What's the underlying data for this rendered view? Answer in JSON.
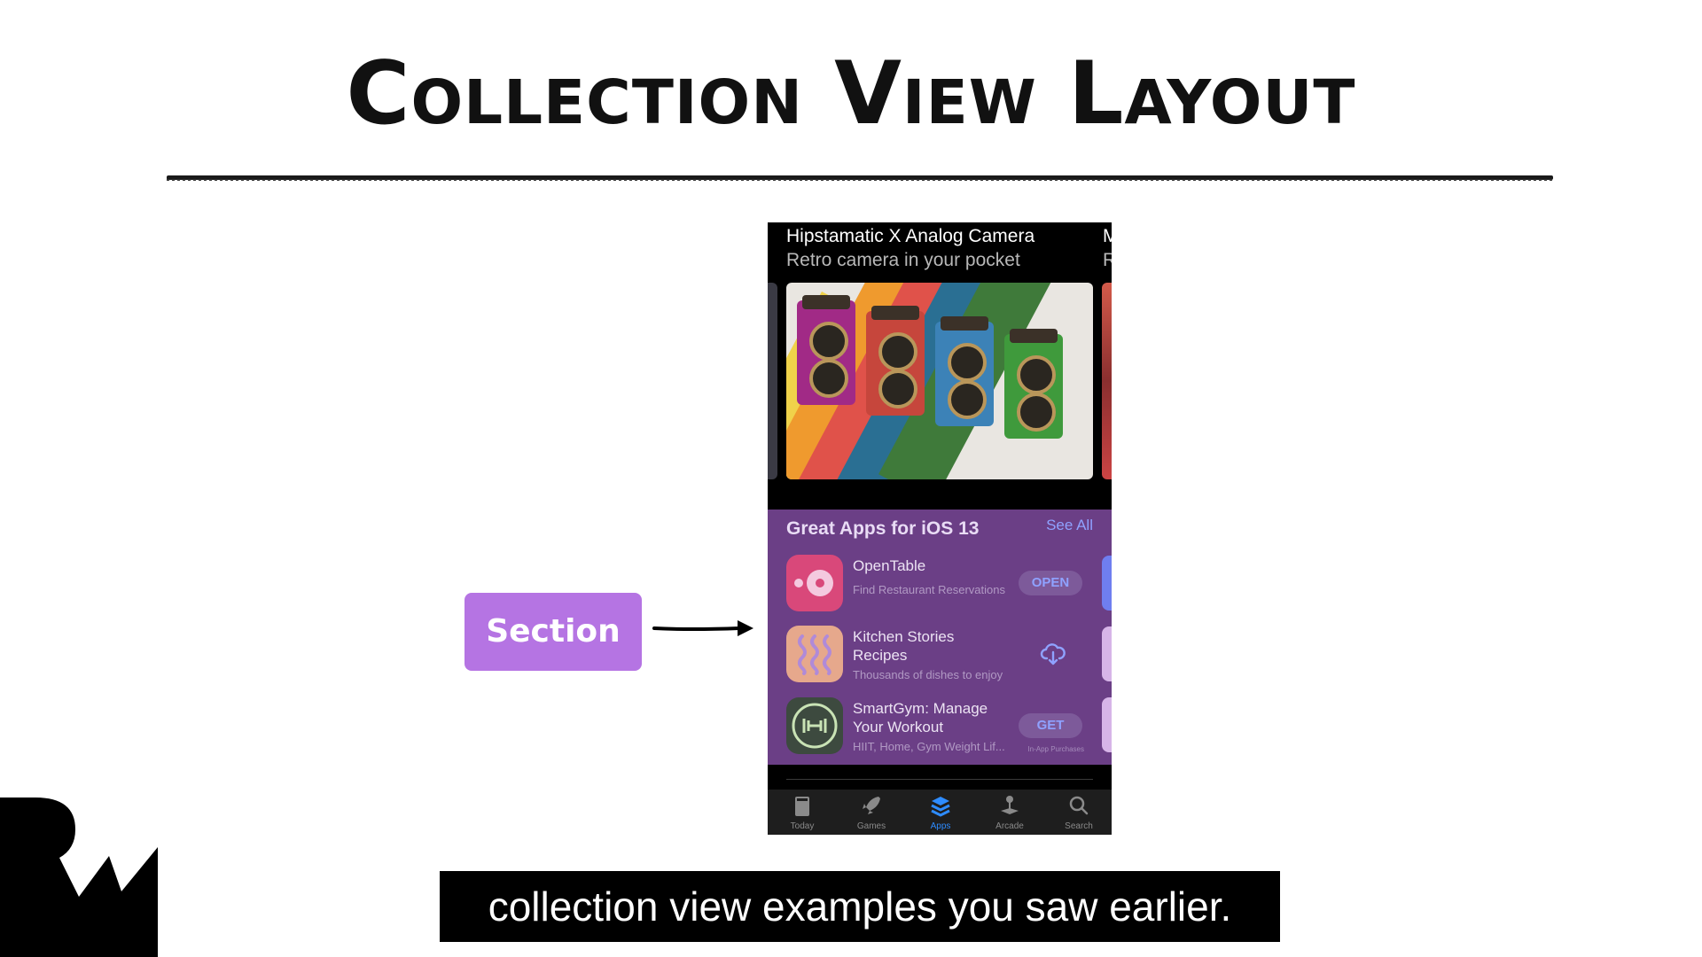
{
  "slide": {
    "title": "Collection View Layout",
    "section_label": "Section",
    "caption": "collection view examples you saw earlier."
  },
  "phone": {
    "featured": {
      "title": "Hipstamatic X Analog Camera",
      "subtitle": "Retro camera in your pocket",
      "peek_title": "M",
      "peek_subtitle": "R"
    },
    "section": {
      "title": "Great Apps for iOS 13",
      "see_all": "See All",
      "apps": [
        {
          "name": "OpenTable",
          "subtitle": "Find Restaurant Reservations",
          "action": "OPEN",
          "icon": "opentable-icon",
          "icon_color": "#d9487a"
        },
        {
          "name": "Kitchen Stories Recipes",
          "subtitle": "Thousands of dishes to enjoy",
          "action": "download-cloud-icon",
          "icon": "kitchen-stories-icon",
          "icon_color": "#e6a88c"
        },
        {
          "name": "SmartGym: Manage Your Workout",
          "subtitle": "HIIT, Home, Gym Weight Lif...",
          "action": "GET",
          "action_note": "In-App Purchases",
          "icon": "smartgym-icon",
          "icon_color": "#3d4a3f"
        }
      ]
    },
    "tabbar": {
      "tabs": [
        {
          "label": "Today",
          "icon": "today-icon",
          "active": false
        },
        {
          "label": "Games",
          "icon": "rocket-icon",
          "active": false
        },
        {
          "label": "Apps",
          "icon": "apps-stack-icon",
          "active": true
        },
        {
          "label": "Arcade",
          "icon": "joystick-icon",
          "active": false
        },
        {
          "label": "Search",
          "icon": "search-icon",
          "active": false
        }
      ]
    }
  },
  "colors": {
    "section_bg": "#6b3f86",
    "label_bg": "#b574e3",
    "accent_blue": "#8fa2ff",
    "active_tab": "#2e8cff"
  }
}
